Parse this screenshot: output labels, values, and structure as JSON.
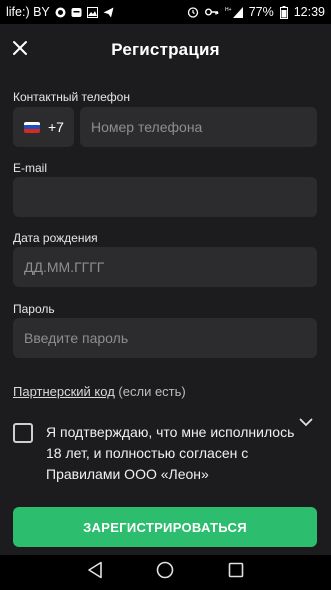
{
  "status_bar": {
    "carrier": "life:) BY",
    "battery": "77%",
    "time": "12:39",
    "network": "H+"
  },
  "header": {
    "title": "Регистрация",
    "close_icon": "close-icon"
  },
  "form": {
    "phone": {
      "label": "Контактный телефон",
      "country_code": "+7",
      "country_flag": "russia-flag",
      "placeholder": "Номер телефона",
      "value": ""
    },
    "email": {
      "label": "E-mail",
      "placeholder": "",
      "value": ""
    },
    "birthdate": {
      "label": "Дата рождения",
      "placeholder": "ДД.ММ.ГГГГ",
      "value": ""
    },
    "password": {
      "label": "Пароль",
      "placeholder": "Введите пароль",
      "value": ""
    },
    "partner_code": {
      "link": "Партнерский код",
      "note": " (если есть)"
    },
    "consent": {
      "text": "Я подтверждаю, что мне исполнилось 18 лет, и полностью согласен с Правилами ООО «Леон»",
      "checked": false
    },
    "submit_label": "ЗАРЕГИСТРИРОВАТЬСЯ"
  },
  "colors": {
    "background": "#1c1c1e",
    "input_bg": "#2c2c2e",
    "accent": "#2dbd6e"
  }
}
